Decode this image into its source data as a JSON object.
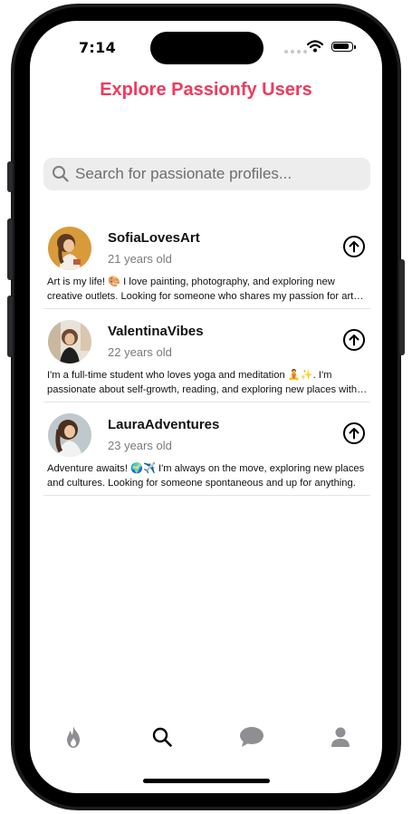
{
  "status_bar": {
    "time": "7:14"
  },
  "header": {
    "title": "Explore Passionfy Users"
  },
  "search": {
    "placeholder": "Search for passionate profiles..."
  },
  "profiles": [
    {
      "name": "SofiaLovesArt",
      "age": "21 years old",
      "bio": "Art is my life! 🎨 I love painting, photography, and exploring new creative outlets. Looking for someone who shares my passion for art and adventure."
    },
    {
      "name": "ValentinaVibes",
      "age": "22 years old",
      "bio": "I'm a full-time student who loves yoga and meditation 🧘✨. I'm passionate about self-growth, reading, and exploring new places with an open mind."
    },
    {
      "name": "LauraAdventures",
      "age": "23 years old",
      "bio": "Adventure awaits! 🌍✈️ I'm always on the move, exploring new places and cultures. Looking for someone spontaneous and up for anything."
    }
  ],
  "tabbar": {
    "items": [
      "flame-icon",
      "search-icon",
      "chat-bubble-icon",
      "person-icon"
    ],
    "active": "search-icon"
  },
  "colors": {
    "accent": "#ef3a5d",
    "search_bg": "#ededee",
    "inactive_tab": "#8e8e93"
  }
}
